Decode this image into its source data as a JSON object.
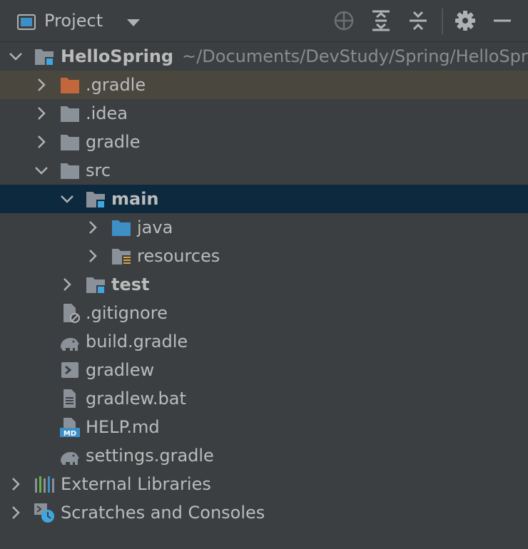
{
  "header": {
    "title": "Project"
  },
  "tree": {
    "root": {
      "name": "HelloSpring",
      "path": "~/Documents/DevStudy/Spring/HelloSpr"
    },
    "items": [
      {
        "label": ".gradle"
      },
      {
        "label": ".idea"
      },
      {
        "label": "gradle"
      },
      {
        "label": "src"
      },
      {
        "label": "main"
      },
      {
        "label": "java"
      },
      {
        "label": "resources"
      },
      {
        "label": "test"
      },
      {
        "label": ".gitignore"
      },
      {
        "label": "build.gradle"
      },
      {
        "label": "gradlew"
      },
      {
        "label": "gradlew.bat"
      },
      {
        "label": "HELP.md"
      },
      {
        "label": "settings.gradle"
      },
      {
        "label": "External Libraries"
      },
      {
        "label": "Scratches and Consoles"
      }
    ]
  },
  "colors": {
    "background": "#3c3f41",
    "selected_row": "#0d293e",
    "excluded_row": "#4a473f",
    "folder": "#8a9199",
    "excluded_folder": "#c2673c",
    "source_folder": "#3d8fc6",
    "module_badge": "#40a6e0"
  }
}
